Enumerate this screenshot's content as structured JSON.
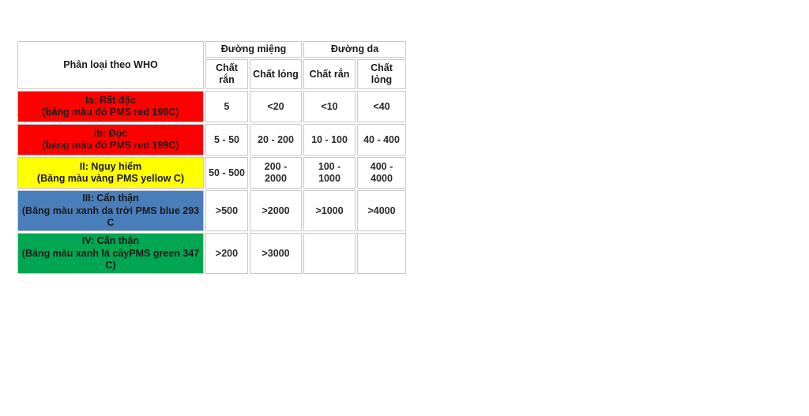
{
  "table": {
    "first_column_header": "Phân loại theo WHO",
    "groups": [
      {
        "label": "Đường miệng"
      },
      {
        "label": "Đường da"
      }
    ],
    "subheaders": [
      {
        "label_line1": "Chất",
        "label_line2": "rắn",
        "single": "Chất rắn"
      },
      {
        "label_line1": "Chất",
        "label_line2": "lỏng",
        "single": "Chất lỏng"
      },
      {
        "label_line1": "Chất rắn",
        "label_line2": "",
        "single": "Chất rắn"
      },
      {
        "label_line1": "Chất",
        "label_line2": "lỏng",
        "single": "Chất lỏng"
      }
    ],
    "rows": [
      {
        "id": "ia",
        "title": "Ia: Rất độc",
        "subtitle": "(băng màu đỏ PMS red 199C)",
        "band_color": "#fe0000",
        "oral_solid": "5",
        "oral_liquid": "<20",
        "dermal_solid": "<10",
        "dermal_liquid": "<40"
      },
      {
        "id": "ib",
        "title": "Ib: Độc",
        "subtitle": "(băng màu đỏ PMS red 199C)",
        "band_color": "#fe0000",
        "oral_solid": "5 - 50",
        "oral_liquid": "20 - 200",
        "dermal_solid": "10 - 100",
        "dermal_liquid": "40 - 400"
      },
      {
        "id": "ii",
        "title": "II: Nguy hiểm",
        "subtitle": "(Băng màu vàng PMS yellow C)",
        "band_color": "#ffff00",
        "oral_solid": "50 - 500",
        "oral_liquid": "200 - 2000",
        "dermal_solid": "100 - 1000",
        "dermal_liquid": "400 - 4000"
      },
      {
        "id": "iii",
        "title": "III: Cẩn thận",
        "subtitle": "(Băng màu xanh da trời PMS blue 293 C",
        "band_color": "#4a7ebb",
        "oral_solid": ">500",
        "oral_liquid": ">2000",
        "dermal_solid": ">1000",
        "dermal_liquid": ">4000"
      },
      {
        "id": "iv",
        "title": "IV: Cẩn thận",
        "subtitle": "(Băng màu xanh lá câyPMS green 347 C)",
        "band_color": "#00a651",
        "oral_solid": ">200",
        "oral_liquid": ">3000",
        "dermal_solid": "",
        "dermal_liquid": ""
      }
    ]
  }
}
